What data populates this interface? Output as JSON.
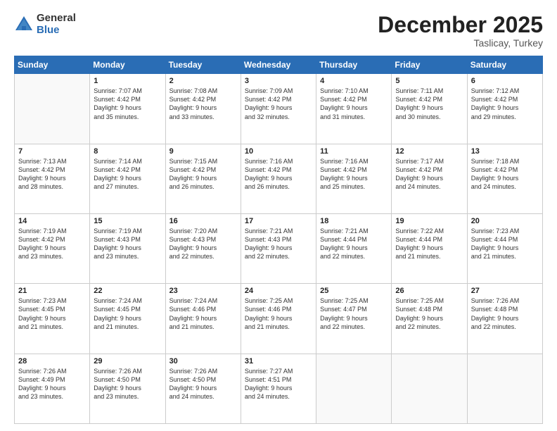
{
  "logo": {
    "general": "General",
    "blue": "Blue"
  },
  "title": {
    "month_year": "December 2025",
    "location": "Taslicay, Turkey"
  },
  "weekdays": [
    "Sunday",
    "Monday",
    "Tuesday",
    "Wednesday",
    "Thursday",
    "Friday",
    "Saturday"
  ],
  "weeks": [
    [
      {
        "day": "",
        "info": ""
      },
      {
        "day": "1",
        "info": "Sunrise: 7:07 AM\nSunset: 4:42 PM\nDaylight: 9 hours\nand 35 minutes."
      },
      {
        "day": "2",
        "info": "Sunrise: 7:08 AM\nSunset: 4:42 PM\nDaylight: 9 hours\nand 33 minutes."
      },
      {
        "day": "3",
        "info": "Sunrise: 7:09 AM\nSunset: 4:42 PM\nDaylight: 9 hours\nand 32 minutes."
      },
      {
        "day": "4",
        "info": "Sunrise: 7:10 AM\nSunset: 4:42 PM\nDaylight: 9 hours\nand 31 minutes."
      },
      {
        "day": "5",
        "info": "Sunrise: 7:11 AM\nSunset: 4:42 PM\nDaylight: 9 hours\nand 30 minutes."
      },
      {
        "day": "6",
        "info": "Sunrise: 7:12 AM\nSunset: 4:42 PM\nDaylight: 9 hours\nand 29 minutes."
      }
    ],
    [
      {
        "day": "7",
        "info": "Sunrise: 7:13 AM\nSunset: 4:42 PM\nDaylight: 9 hours\nand 28 minutes."
      },
      {
        "day": "8",
        "info": "Sunrise: 7:14 AM\nSunset: 4:42 PM\nDaylight: 9 hours\nand 27 minutes."
      },
      {
        "day": "9",
        "info": "Sunrise: 7:15 AM\nSunset: 4:42 PM\nDaylight: 9 hours\nand 26 minutes."
      },
      {
        "day": "10",
        "info": "Sunrise: 7:16 AM\nSunset: 4:42 PM\nDaylight: 9 hours\nand 26 minutes."
      },
      {
        "day": "11",
        "info": "Sunrise: 7:16 AM\nSunset: 4:42 PM\nDaylight: 9 hours\nand 25 minutes."
      },
      {
        "day": "12",
        "info": "Sunrise: 7:17 AM\nSunset: 4:42 PM\nDaylight: 9 hours\nand 24 minutes."
      },
      {
        "day": "13",
        "info": "Sunrise: 7:18 AM\nSunset: 4:42 PM\nDaylight: 9 hours\nand 24 minutes."
      }
    ],
    [
      {
        "day": "14",
        "info": "Sunrise: 7:19 AM\nSunset: 4:42 PM\nDaylight: 9 hours\nand 23 minutes."
      },
      {
        "day": "15",
        "info": "Sunrise: 7:19 AM\nSunset: 4:43 PM\nDaylight: 9 hours\nand 23 minutes."
      },
      {
        "day": "16",
        "info": "Sunrise: 7:20 AM\nSunset: 4:43 PM\nDaylight: 9 hours\nand 22 minutes."
      },
      {
        "day": "17",
        "info": "Sunrise: 7:21 AM\nSunset: 4:43 PM\nDaylight: 9 hours\nand 22 minutes."
      },
      {
        "day": "18",
        "info": "Sunrise: 7:21 AM\nSunset: 4:44 PM\nDaylight: 9 hours\nand 22 minutes."
      },
      {
        "day": "19",
        "info": "Sunrise: 7:22 AM\nSunset: 4:44 PM\nDaylight: 9 hours\nand 21 minutes."
      },
      {
        "day": "20",
        "info": "Sunrise: 7:23 AM\nSunset: 4:44 PM\nDaylight: 9 hours\nand 21 minutes."
      }
    ],
    [
      {
        "day": "21",
        "info": "Sunrise: 7:23 AM\nSunset: 4:45 PM\nDaylight: 9 hours\nand 21 minutes."
      },
      {
        "day": "22",
        "info": "Sunrise: 7:24 AM\nSunset: 4:45 PM\nDaylight: 9 hours\nand 21 minutes."
      },
      {
        "day": "23",
        "info": "Sunrise: 7:24 AM\nSunset: 4:46 PM\nDaylight: 9 hours\nand 21 minutes."
      },
      {
        "day": "24",
        "info": "Sunrise: 7:25 AM\nSunset: 4:46 PM\nDaylight: 9 hours\nand 21 minutes."
      },
      {
        "day": "25",
        "info": "Sunrise: 7:25 AM\nSunset: 4:47 PM\nDaylight: 9 hours\nand 22 minutes."
      },
      {
        "day": "26",
        "info": "Sunrise: 7:25 AM\nSunset: 4:48 PM\nDaylight: 9 hours\nand 22 minutes."
      },
      {
        "day": "27",
        "info": "Sunrise: 7:26 AM\nSunset: 4:48 PM\nDaylight: 9 hours\nand 22 minutes."
      }
    ],
    [
      {
        "day": "28",
        "info": "Sunrise: 7:26 AM\nSunset: 4:49 PM\nDaylight: 9 hours\nand 23 minutes."
      },
      {
        "day": "29",
        "info": "Sunrise: 7:26 AM\nSunset: 4:50 PM\nDaylight: 9 hours\nand 23 minutes."
      },
      {
        "day": "30",
        "info": "Sunrise: 7:26 AM\nSunset: 4:50 PM\nDaylight: 9 hours\nand 24 minutes."
      },
      {
        "day": "31",
        "info": "Sunrise: 7:27 AM\nSunset: 4:51 PM\nDaylight: 9 hours\nand 24 minutes."
      },
      {
        "day": "",
        "info": ""
      },
      {
        "day": "",
        "info": ""
      },
      {
        "day": "",
        "info": ""
      }
    ]
  ]
}
